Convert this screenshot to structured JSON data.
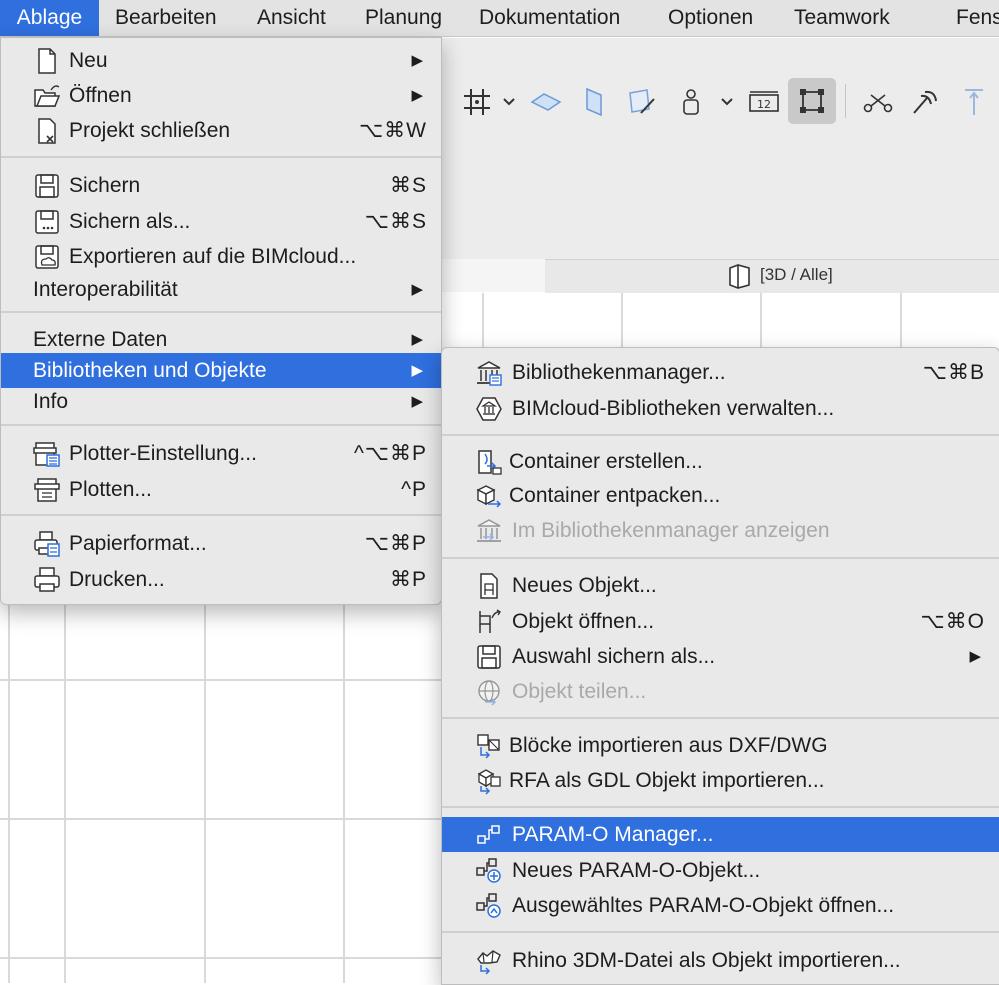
{
  "menubar": {
    "items": [
      "Ablage",
      "Bearbeiten",
      "Ansicht",
      "Planung",
      "Dokumentation",
      "Optionen",
      "Teamwork",
      "Fenste"
    ]
  },
  "view_tab": {
    "label": "[3D / Alle]"
  },
  "menu_main": {
    "items": [
      {
        "label": "Neu",
        "shortcut": "",
        "submenu": true,
        "icon": "new-document-icon"
      },
      {
        "label": "Öffnen",
        "shortcut": "",
        "submenu": true,
        "icon": "open-folder-icon"
      },
      {
        "label": "Projekt schließen",
        "shortcut": "⌥⌘W",
        "submenu": false,
        "icon": "close-document-icon"
      },
      {
        "label": "Sichern",
        "shortcut": "⌘S",
        "submenu": false,
        "icon": "save-icon"
      },
      {
        "label": "Sichern als...",
        "shortcut": "⌥⌘S",
        "submenu": false,
        "icon": "save-as-icon"
      },
      {
        "label": "Exportieren auf die BIMcloud...",
        "shortcut": "",
        "submenu": false,
        "icon": "export-cloud-icon"
      },
      {
        "label": "Interoperabilität",
        "shortcut": "",
        "submenu": true,
        "icon": ""
      },
      {
        "label": "Externe Daten",
        "shortcut": "",
        "submenu": true,
        "icon": ""
      },
      {
        "label": "Bibliotheken und Objekte",
        "shortcut": "",
        "submenu": true,
        "icon": ""
      },
      {
        "label": "Info",
        "shortcut": "",
        "submenu": true,
        "icon": ""
      },
      {
        "label": "Plotter-Einstellung...",
        "shortcut": "^⌥⌘P",
        "submenu": false,
        "icon": "plotter-setup-icon"
      },
      {
        "label": "Plotten...",
        "shortcut": "^P",
        "submenu": false,
        "icon": "plotter-icon"
      },
      {
        "label": "Papierformat...",
        "shortcut": "⌥⌘P",
        "submenu": false,
        "icon": "page-setup-icon"
      },
      {
        "label": "Drucken...",
        "shortcut": "⌘P",
        "submenu": false,
        "icon": "printer-icon"
      }
    ]
  },
  "menu_sub": {
    "items": [
      {
        "label": "Bibliothekenmanager...",
        "shortcut": "⌥⌘B",
        "submenu": false,
        "icon": "library-manager-icon",
        "disabled": false
      },
      {
        "label": "BIMcloud-Bibliotheken verwalten...",
        "shortcut": "",
        "submenu": false,
        "icon": "bimcloud-library-icon",
        "disabled": false
      },
      {
        "label": "Container erstellen...",
        "shortcut": "",
        "submenu": false,
        "icon": "container-create-icon",
        "disabled": false
      },
      {
        "label": "Container entpacken...",
        "shortcut": "",
        "submenu": false,
        "icon": "container-extract-icon",
        "disabled": false
      },
      {
        "label": "Im Bibliothekenmanager anzeigen",
        "shortcut": "",
        "submenu": false,
        "icon": "show-in-library-icon",
        "disabled": true
      },
      {
        "label": "Neues Objekt...",
        "shortcut": "",
        "submenu": false,
        "icon": "new-object-icon",
        "disabled": false
      },
      {
        "label": "Objekt öffnen...",
        "shortcut": "⌥⌘O",
        "submenu": false,
        "icon": "open-object-icon",
        "disabled": false
      },
      {
        "label": "Auswahl sichern als...",
        "shortcut": "",
        "submenu": true,
        "icon": "save-selection-icon",
        "disabled": false
      },
      {
        "label": "Objekt teilen...",
        "shortcut": "",
        "submenu": false,
        "icon": "share-object-icon",
        "disabled": true
      },
      {
        "label": "Blöcke importieren aus DXF/DWG",
        "shortcut": "",
        "submenu": false,
        "icon": "import-dxf-icon",
        "disabled": false
      },
      {
        "label": "RFA als GDL Objekt importieren...",
        "shortcut": "",
        "submenu": false,
        "icon": "import-rfa-icon",
        "disabled": false
      },
      {
        "label": "PARAM-O Manager...",
        "shortcut": "",
        "submenu": false,
        "icon": "param-o-manager-icon",
        "disabled": false
      },
      {
        "label": "Neues PARAM-O-Objekt...",
        "shortcut": "",
        "submenu": false,
        "icon": "new-param-o-icon",
        "disabled": false
      },
      {
        "label": "Ausgewähltes PARAM-O-Objekt öffnen...",
        "shortcut": "",
        "submenu": false,
        "icon": "open-param-o-icon",
        "disabled": false
      },
      {
        "label": "Rhino 3DM-Datei als Objekt importieren...",
        "shortcut": "",
        "submenu": false,
        "icon": "import-rhino-icon",
        "disabled": false
      }
    ]
  },
  "arrow_glyph": "▶",
  "colors": {
    "highlight": "#2f6fde",
    "menu_bg": "#e9e9e9",
    "disabled": "#a9a9a9"
  }
}
